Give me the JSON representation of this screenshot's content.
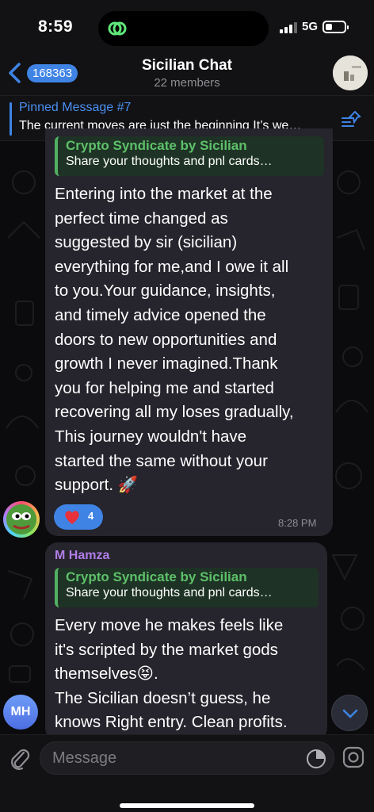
{
  "status_bar": {
    "time": "8:59",
    "network": "5G",
    "battery_level": 0.35
  },
  "header": {
    "back_count": "168363",
    "title": "Sicilian Chat",
    "subtitle": "22 members"
  },
  "pinned": {
    "title": "Pinned Message #7",
    "text": "The current moves are just the beginning It’s we…"
  },
  "messages": [
    {
      "reply_title": "Crypto Syndicate by Sicilian",
      "reply_text": "Share your thoughts and pnl cards…",
      "text": "Entering into  the market at the\nperfect time changed as\nsuggested by sir (sicilian)\neverything for me,and I owe it all\nto you.Your guidance, insights,\nand timely advice opened the\ndoors to new opportunities and\ngrowth I never imagined.Thank\nyou for helping me and started\nrecovering all my loses gradually,\nThis journey wouldn't have\nstarted the same without your\nsupport. 🚀",
      "reaction_count": "4",
      "time": "8:28 PM"
    },
    {
      "sender": "M Hamza",
      "reply_title": "Crypto Syndicate by Sicilian",
      "reply_text": "Share your thoughts and pnl cards…",
      "text": "Every move he makes feels like\nit's scripted by the market gods\nthemselves😝.\nThe Sicilian doesn’t guess, he\nknows Right entry. Clean profits.",
      "avatar_initials": "MH"
    }
  ],
  "input": {
    "placeholder": "Message"
  },
  "colors": {
    "accent": "#3f84e5",
    "reply_green": "#5ec06a",
    "sender_purple": "#b07ee8",
    "bubble": "#26242c"
  },
  "icons": [
    "back-chevron-icon",
    "pin-list-icon",
    "heart-icon",
    "chevron-down-icon",
    "paperclip-icon",
    "sticker-icon",
    "camera-icon"
  ]
}
